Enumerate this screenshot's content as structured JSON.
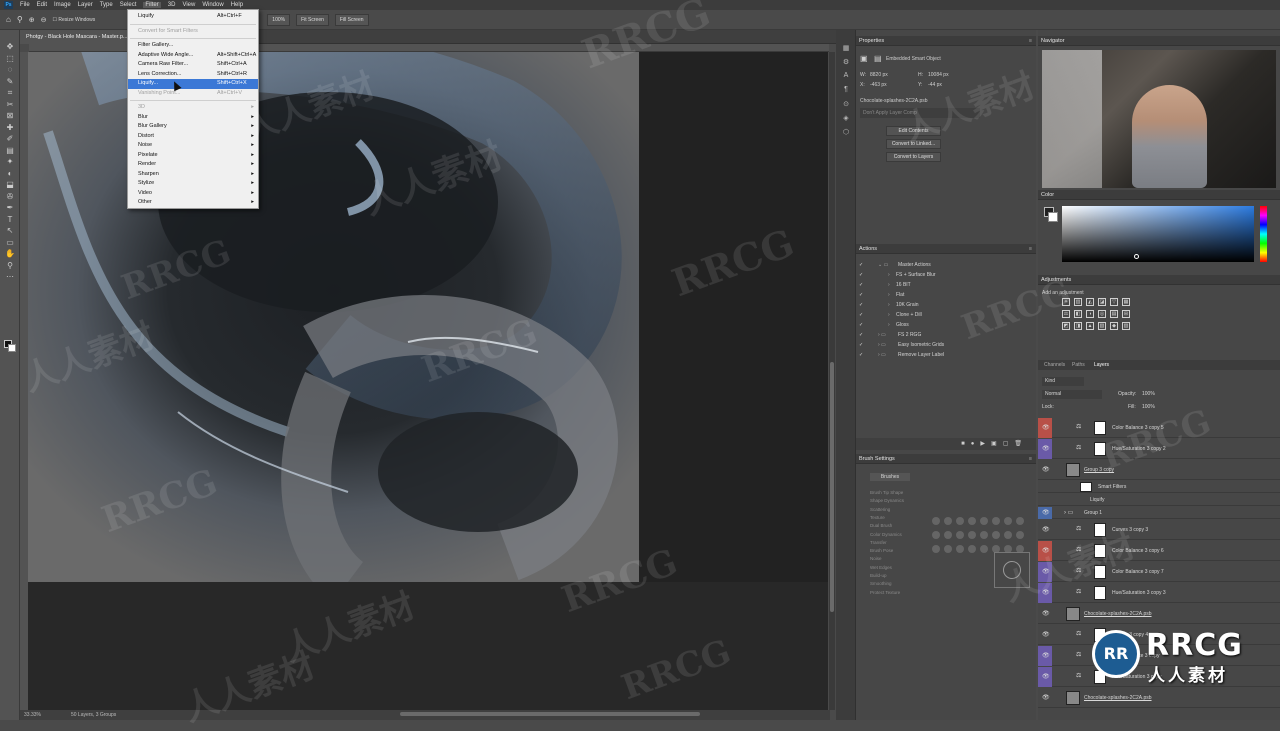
{
  "menubar": {
    "items": [
      "File",
      "Edit",
      "Image",
      "Layer",
      "Type",
      "Select",
      "Filter",
      "3D",
      "View",
      "Window",
      "Help"
    ]
  },
  "optbar": {
    "resize_windows": "Resize Windows",
    "zoom_pct": "100%",
    "fit_screen": "Fit Screen",
    "fill_screen": "Fill Screen"
  },
  "document": {
    "tab_title": "Photgy - Black Hole Mascara - Master.p...",
    "zoom": "33.33%",
    "status": "50 Layers, 3 Groups"
  },
  "filter_menu": {
    "items": [
      {
        "label": "Liquify",
        "shortcut": "Alt+Ctrl+F",
        "disabled": false,
        "hl": false,
        "arrow": false
      },
      {
        "label": "Convert for Smart Filters",
        "shortcut": "",
        "disabled": true,
        "hl": false,
        "arrow": false
      },
      {
        "label": "Filter Gallery...",
        "shortcut": "",
        "disabled": false,
        "hl": false,
        "arrow": false
      },
      {
        "label": "Adaptive Wide Angle...",
        "shortcut": "Alt+Shift+Ctrl+A",
        "disabled": false,
        "hl": false,
        "arrow": false
      },
      {
        "label": "Camera Raw Filter...",
        "shortcut": "Shift+Ctrl+A",
        "disabled": false,
        "hl": false,
        "arrow": false
      },
      {
        "label": "Lens Correction...",
        "shortcut": "Shift+Ctrl+R",
        "disabled": false,
        "hl": false,
        "arrow": false
      },
      {
        "label": "Liquify...",
        "shortcut": "Shift+Ctrl+X",
        "disabled": false,
        "hl": true,
        "arrow": false
      },
      {
        "label": "Vanishing Point...",
        "shortcut": "Alt+Ctrl+V",
        "disabled": true,
        "hl": false,
        "arrow": false
      },
      {
        "label": "3D",
        "shortcut": "",
        "disabled": true,
        "hl": false,
        "arrow": true
      },
      {
        "label": "Blur",
        "shortcut": "",
        "disabled": false,
        "hl": false,
        "arrow": true
      },
      {
        "label": "Blur Gallery",
        "shortcut": "",
        "disabled": false,
        "hl": false,
        "arrow": true
      },
      {
        "label": "Distort",
        "shortcut": "",
        "disabled": false,
        "hl": false,
        "arrow": true
      },
      {
        "label": "Noise",
        "shortcut": "",
        "disabled": false,
        "hl": false,
        "arrow": true
      },
      {
        "label": "Pixelate",
        "shortcut": "",
        "disabled": false,
        "hl": false,
        "arrow": true
      },
      {
        "label": "Render",
        "shortcut": "",
        "disabled": false,
        "hl": false,
        "arrow": true
      },
      {
        "label": "Sharpen",
        "shortcut": "",
        "disabled": false,
        "hl": false,
        "arrow": true
      },
      {
        "label": "Stylize",
        "shortcut": "",
        "disabled": false,
        "hl": false,
        "arrow": true
      },
      {
        "label": "Video",
        "shortcut": "",
        "disabled": false,
        "hl": false,
        "arrow": true
      },
      {
        "label": "Other",
        "shortcut": "",
        "disabled": false,
        "hl": false,
        "arrow": true
      }
    ]
  },
  "properties": {
    "title": "Properties",
    "type": "Embedded Smart Object",
    "w_label": "W:",
    "w": "8820 px",
    "h_label": "H:",
    "h": "10084 px",
    "x_label": "X:",
    "x": "-463 px",
    "y_label": "Y:",
    "y": "-44 px",
    "file": "Chocolate-splashes-2C2A.psb",
    "layer_comp_placeholder": "Don't Apply Layer Comp",
    "edit_contents": "Edit Contents",
    "convert_linked": "Convert to Linked...",
    "convert_layers": "Convert to Layers"
  },
  "actions": {
    "title": "Actions",
    "items": [
      "Master Actions",
      "FS + Surface Blur",
      "16 BIT",
      "Flat",
      "10K Grain",
      "Clone + Dill",
      "Gloss",
      "FS 2 RGG",
      "Easy Isometric Grids",
      "Remove Layer Label"
    ]
  },
  "brush_settings": {
    "title": "Brush Settings",
    "brushes_btn": "Brushes",
    "options": [
      "Brush Tip Shape",
      "Shape Dynamics",
      "Scattering",
      "Texture",
      "Dual Brush",
      "Color Dynamics",
      "Transfer",
      "Brush Pose",
      "Noise",
      "Wet Edges",
      "Build-up",
      "Smoothing",
      "Protect Texture"
    ]
  },
  "navigator": {
    "title": "Navigator"
  },
  "color": {
    "title": "Color"
  },
  "adjustments": {
    "title": "Adjustments",
    "add_label": "Add an adjustment"
  },
  "layers": {
    "tabs": [
      "Channels",
      "Paths",
      "Layers"
    ],
    "kind": "Kind",
    "blend": "Normal",
    "opacity_label": "Opacity:",
    "opacity": "100%",
    "lock_label": "Lock:",
    "fill_label": "Fill:",
    "fill": "100%",
    "rows": [
      {
        "name": "Color Balance 3 copy 5",
        "swatch": "#b85048",
        "type": "adj",
        "indent": 0
      },
      {
        "name": "Hue/Saturation 3 copy 2",
        "swatch": "#6a5aa8",
        "type": "adj",
        "indent": 0
      },
      {
        "name": "Group 3 copy",
        "swatch": "",
        "type": "smart",
        "indent": 0
      },
      {
        "name": "Smart Filters",
        "swatch": "",
        "type": "filter",
        "indent": 1
      },
      {
        "name": "Liquify",
        "swatch": "",
        "type": "sub",
        "indent": 2
      },
      {
        "name": "Group 1",
        "swatch": "#4a6aa8",
        "type": "group",
        "indent": 0
      },
      {
        "name": "Curves 3 copy 3",
        "swatch": "",
        "type": "adj",
        "indent": 0
      },
      {
        "name": "Color Balance 3 copy 6",
        "swatch": "#b85048",
        "type": "adj",
        "indent": 0
      },
      {
        "name": "Color Balance 3 copy 7",
        "swatch": "#6a5aa8",
        "type": "adj",
        "indent": 0
      },
      {
        "name": "Hue/Saturation 3 copy 3",
        "swatch": "#6a5aa8",
        "type": "adj",
        "indent": 0
      },
      {
        "name": "Chocolate-splashes-2C2A.psb",
        "swatch": "",
        "type": "smart",
        "indent": 0
      },
      {
        "name": "Curves 3 copy 4",
        "swatch": "",
        "type": "adj",
        "indent": 0
      },
      {
        "name": "Color Balance 3 copy",
        "swatch": "#6a5aa8",
        "type": "adj",
        "indent": 0
      },
      {
        "name": "Hue/Saturation 3 copy",
        "swatch": "#6a5aa8",
        "type": "adj",
        "indent": 0
      },
      {
        "name": "Chocolate-splashes-2C2A.psb",
        "swatch": "",
        "type": "smart",
        "indent": 0
      }
    ]
  },
  "watermark": {
    "text_a": "RRCG",
    "text_b": "人人素材",
    "logo_big": "RRCG",
    "logo_cn": "人人素材",
    "logo_mark": "RR"
  }
}
